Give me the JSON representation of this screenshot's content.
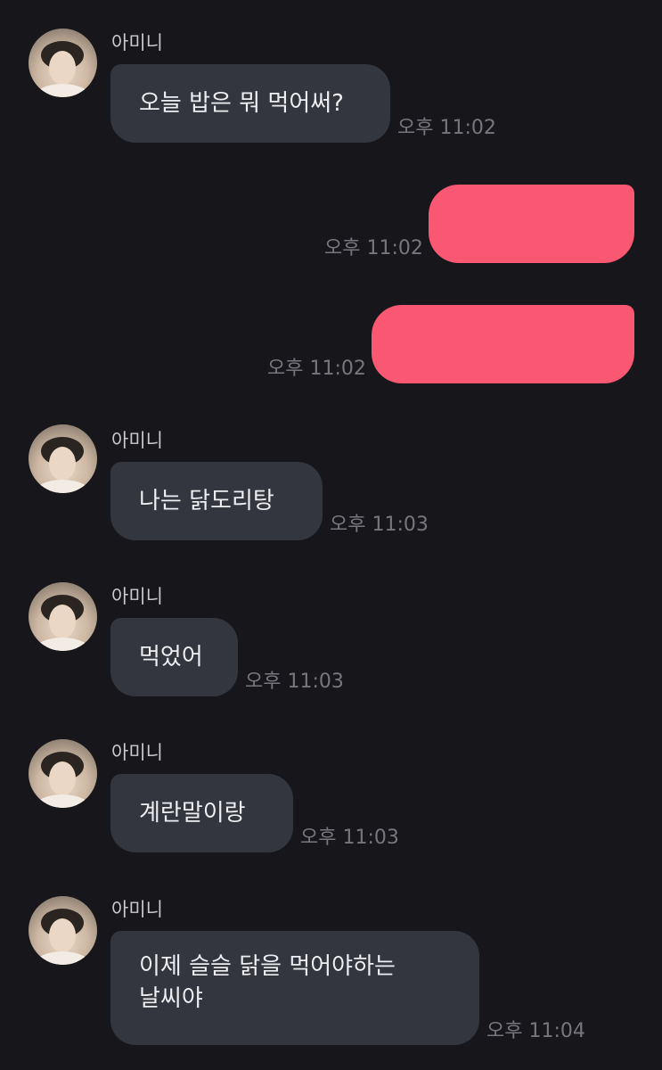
{
  "contact": {
    "name": "아미니"
  },
  "messages": [
    {
      "from": "other",
      "text": "오늘 밥은 뭐 먹어써?",
      "time": "오후 11:02"
    },
    {
      "from": "me",
      "text": "",
      "time": "오후 11:02"
    },
    {
      "from": "me",
      "text": "",
      "time": "오후 11:02"
    },
    {
      "from": "other",
      "text": "나는 닭도리탕",
      "time": "오후 11:03"
    },
    {
      "from": "other",
      "text": "먹었어",
      "time": "오후 11:03"
    },
    {
      "from": "other",
      "text": "계란말이랑",
      "time": "오후 11:03"
    },
    {
      "from": "other",
      "lines": [
        "이제 슬슬 닭을 먹어야하는",
        "날씨야"
      ],
      "time": "오후 11:04"
    }
  ],
  "colors": {
    "background": "#17171b",
    "incoming_bubble": "#33363d",
    "outgoing_bubble": "#f95772",
    "timestamp": "#76767c"
  },
  "icons": [
    "profile-avatar"
  ]
}
